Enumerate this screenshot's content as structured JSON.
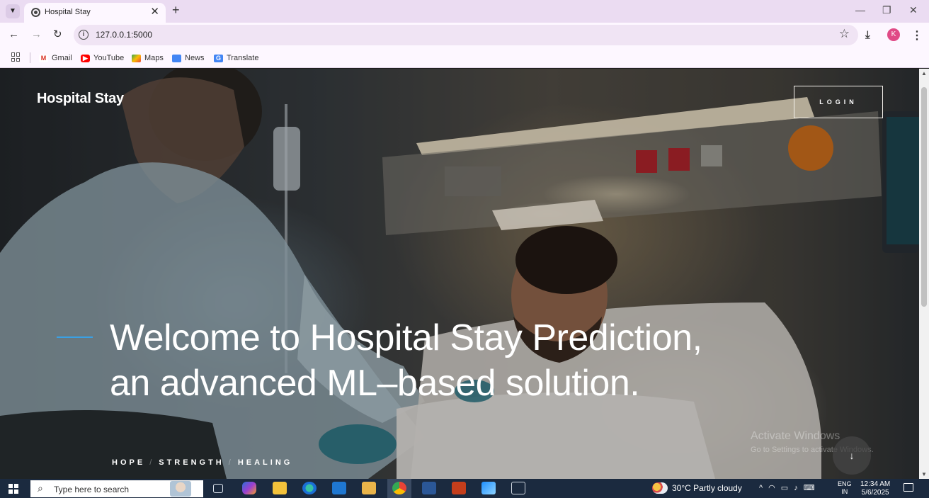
{
  "browser": {
    "tab_title": "Hospital Stay",
    "url": "127.0.0.1:5000",
    "profile_initial": "K",
    "bookmarks": [
      {
        "label": "Gmail",
        "icon": "gmail-icon",
        "color": "#d93025"
      },
      {
        "label": "YouTube",
        "icon": "youtube-icon",
        "color": "#ff0000"
      },
      {
        "label": "Maps",
        "icon": "maps-icon",
        "color": "#34a853"
      },
      {
        "label": "News",
        "icon": "news-icon",
        "color": "#4285f4"
      },
      {
        "label": "Translate",
        "icon": "translate-icon",
        "color": "#4285f4"
      }
    ]
  },
  "page": {
    "brand": "Hospital Stay",
    "login_label": "LOGIN",
    "hero_title_line1": "Welcome to Hospital Stay Prediction,",
    "hero_title_line2": "an advanced ML–based solution.",
    "tagline": [
      "HOPE",
      "STRENGTH",
      "HEALING"
    ],
    "accent_color": "#3aa0e4",
    "watermark_title": "Activate Windows",
    "watermark_subtitle": "Go to Settings to activate Windows."
  },
  "taskbar": {
    "search_placeholder": "Type here to search",
    "weather": "30°C  Partly cloudy",
    "lang_top": "ENG",
    "lang_bottom": "IN",
    "time": "12:34 AM",
    "date": "5/6/2025"
  }
}
